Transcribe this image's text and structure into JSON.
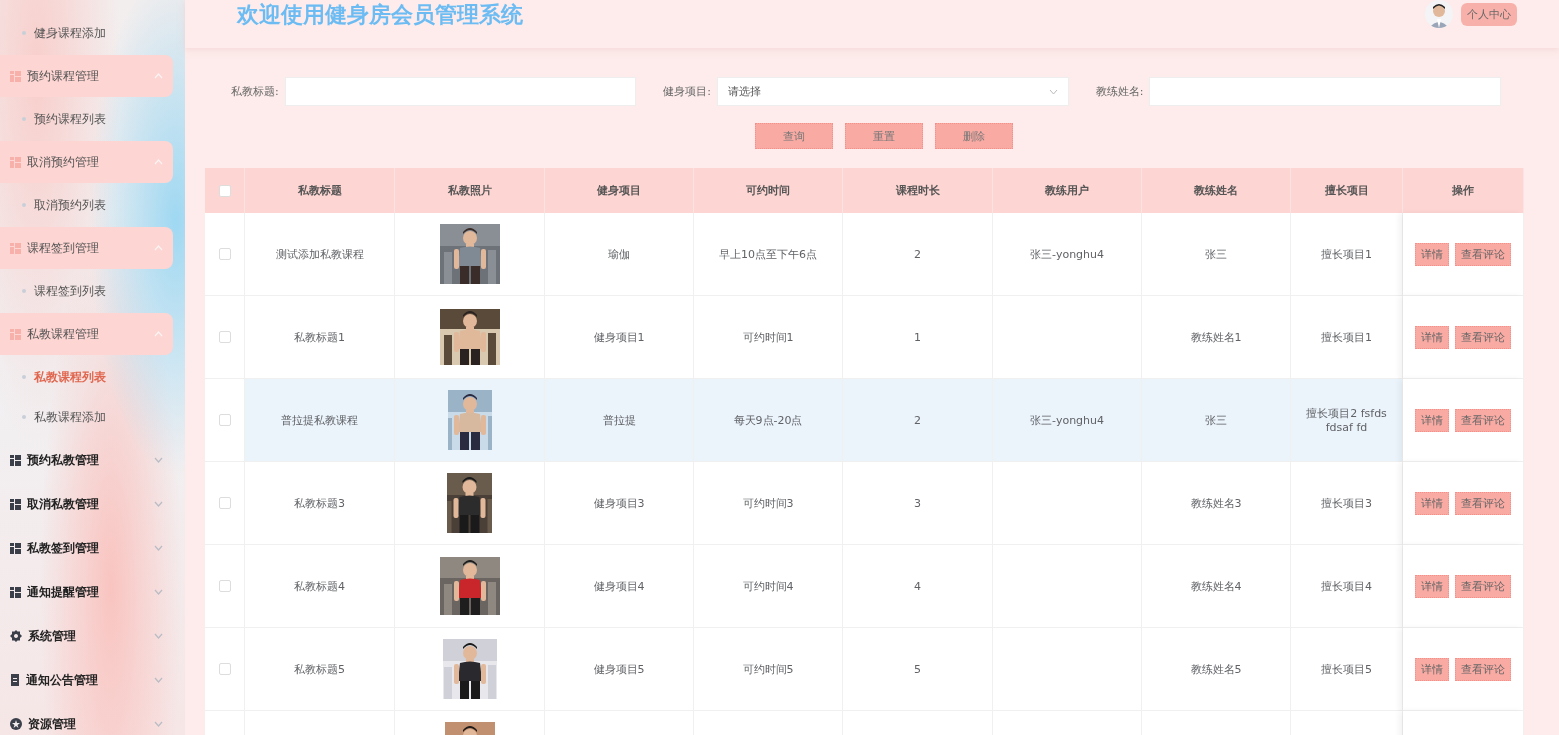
{
  "sidebar": {
    "partial_children": [
      {
        "label": "健身课程添加",
        "selected": false
      }
    ],
    "groups": [
      {
        "label": "预约课程管理",
        "kind": "grid",
        "expanded": true,
        "children": [
          {
            "label": "预约课程列表",
            "selected": false
          }
        ]
      },
      {
        "label": "取消预约管理",
        "kind": "grid",
        "expanded": true,
        "children": [
          {
            "label": "取消预约列表",
            "selected": false
          }
        ]
      },
      {
        "label": "课程签到管理",
        "kind": "grid",
        "expanded": true,
        "children": [
          {
            "label": "课程签到列表",
            "selected": false
          }
        ]
      },
      {
        "label": "私教课程管理",
        "kind": "grid",
        "expanded": true,
        "children": [
          {
            "label": "私教课程列表",
            "selected": true
          },
          {
            "label": "私教课程添加",
            "selected": false
          }
        ]
      },
      {
        "label": "预约私教管理",
        "kind": "grid",
        "expanded": false
      },
      {
        "label": "取消私教管理",
        "kind": "grid",
        "expanded": false
      },
      {
        "label": "私教签到管理",
        "kind": "grid",
        "expanded": false
      },
      {
        "label": "通知提醒管理",
        "kind": "grid",
        "expanded": false
      },
      {
        "label": "系统管理",
        "kind": "system",
        "expanded": false
      },
      {
        "label": "通知公告管理",
        "kind": "notice",
        "expanded": false
      },
      {
        "label": "资源管理",
        "kind": "resource",
        "expanded": false
      }
    ]
  },
  "header": {
    "title": "欢迎使用健身房会员管理系统",
    "avatar": {
      "kind": "picture"
    },
    "profile_button": "个人中心"
  },
  "search": {
    "fields": [
      {
        "label": "私教标题:",
        "kind": "input"
      },
      {
        "label": "健身项目:",
        "kind": "select",
        "placeholder": "请选择"
      },
      {
        "label": "教练姓名:",
        "kind": "input"
      }
    ],
    "buttons": [
      "查询",
      "重置",
      "删除"
    ]
  },
  "table": {
    "select_all": {
      "checked": false
    },
    "columns": [
      "私教标题",
      "私教照片",
      "健身项目",
      "可约时间",
      "课程时长",
      "教练用户",
      "教练姓名",
      "擅长项目",
      "操作"
    ],
    "rows": [
      {
        "checked": false,
        "highlighted": false,
        "title": "测试添加私教课程",
        "photo": {
          "kind": "picture"
        },
        "project": "瑜伽",
        "time": "早上10点至下午6点",
        "duration": "2",
        "coach_user": "张三-yonghu4",
        "coach_name": "张三",
        "specialty": "擅长项目1",
        "actions": [
          "详情",
          "查看评论"
        ]
      },
      {
        "checked": false,
        "highlighted": false,
        "title": "私教标题1",
        "photo": {
          "kind": "picture"
        },
        "project": "健身项目1",
        "time": "可约时间1",
        "duration": "1",
        "coach_name": "教练姓名1",
        "specialty": "擅长项目1",
        "actions": [
          "详情",
          "查看评论"
        ]
      },
      {
        "checked": false,
        "highlighted": true,
        "title": "普拉提私教课程",
        "photo": {
          "kind": "picture"
        },
        "project": "普拉提",
        "time": "每天9点-20点",
        "duration": "2",
        "coach_user": "张三-yonghu4",
        "coach_name": "张三",
        "specialty": "擅长项目2 fsfds fdsaf fd",
        "actions": [
          "详情",
          "查看评论"
        ]
      },
      {
        "checked": false,
        "highlighted": false,
        "title": "私教标题3",
        "photo": {
          "kind": "picture"
        },
        "project": "健身项目3",
        "time": "可约时间3",
        "duration": "3",
        "coach_name": "教练姓名3",
        "specialty": "擅长项目3",
        "actions": [
          "详情",
          "查看评论"
        ]
      },
      {
        "checked": false,
        "highlighted": false,
        "title": "私教标题4",
        "photo": {
          "kind": "picture"
        },
        "project": "健身项目4",
        "time": "可约时间4",
        "duration": "4",
        "coach_name": "教练姓名4",
        "specialty": "擅长项目4",
        "actions": [
          "详情",
          "查看评论"
        ]
      },
      {
        "checked": false,
        "highlighted": false,
        "title": "私教标题5",
        "photo": {
          "kind": "picture"
        },
        "project": "健身项目5",
        "time": "可约时间5",
        "duration": "5",
        "coach_name": "教练姓名5",
        "specialty": "擅长项目5",
        "actions": [
          "详情",
          "查看评论"
        ]
      },
      {
        "photo": {
          "kind": "picture"
        }
      }
    ]
  }
}
